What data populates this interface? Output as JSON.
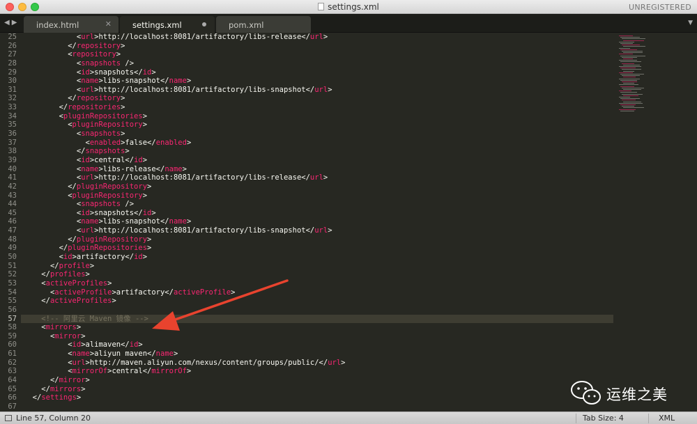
{
  "window": {
    "title": "settings.xml",
    "registration": "UNREGISTERED"
  },
  "tabs": [
    {
      "label": "index.html",
      "state": "clean"
    },
    {
      "label": "settings.xml",
      "state": "clean"
    },
    {
      "label": "pom.xml",
      "state": "modified"
    }
  ],
  "active_tab": "settings.xml",
  "editor": {
    "current_line": 57,
    "lines": [
      {
        "n": "25",
        "indent": 6,
        "parts": [
          [
            "t",
            "<"
          ],
          [
            "url",
            "t2"
          ]
        ]
      },
      {
        "n": "26"
      },
      {
        "n": "27"
      },
      {
        "n": "28"
      },
      {
        "n": "29"
      },
      {
        "n": "30"
      },
      {
        "n": "31"
      },
      {
        "n": "32"
      },
      {
        "n": "33"
      },
      {
        "n": "34"
      },
      {
        "n": "35"
      },
      {
        "n": "36"
      },
      {
        "n": "37"
      },
      {
        "n": "38"
      },
      {
        "n": "39"
      },
      {
        "n": "40"
      },
      {
        "n": "41"
      },
      {
        "n": "42"
      },
      {
        "n": "43"
      },
      {
        "n": "44"
      },
      {
        "n": "45"
      },
      {
        "n": "46"
      },
      {
        "n": "47"
      },
      {
        "n": "48"
      },
      {
        "n": "49"
      },
      {
        "n": "50"
      },
      {
        "n": "51"
      },
      {
        "n": "52"
      },
      {
        "n": "53"
      },
      {
        "n": "54"
      },
      {
        "n": "55"
      },
      {
        "n": "56"
      },
      {
        "n": "57"
      },
      {
        "n": "58"
      },
      {
        "n": "59"
      },
      {
        "n": "60"
      },
      {
        "n": "61"
      },
      {
        "n": "62"
      },
      {
        "n": "63"
      },
      {
        "n": "64"
      },
      {
        "n": "65"
      },
      {
        "n": "66"
      },
      {
        "n": "67"
      }
    ],
    "code": [
      {
        "ind": 6,
        "segs": [
          [
            "p",
            "<"
          ],
          [
            "t",
            "url"
          ],
          [
            "p",
            ">http://localhost:8081/artifactory/libs-release</"
          ],
          [
            "t",
            "url"
          ],
          [
            "p",
            ">"
          ]
        ]
      },
      {
        "ind": 5,
        "segs": [
          [
            "p",
            "</"
          ],
          [
            "t",
            "repository"
          ],
          [
            "p",
            ">"
          ]
        ]
      },
      {
        "ind": 5,
        "segs": [
          [
            "p",
            "<"
          ],
          [
            "t",
            "repository"
          ],
          [
            "p",
            ">"
          ]
        ]
      },
      {
        "ind": 6,
        "segs": [
          [
            "p",
            "<"
          ],
          [
            "t",
            "snapshots"
          ],
          [
            "p",
            " />"
          ]
        ]
      },
      {
        "ind": 6,
        "segs": [
          [
            "p",
            "<"
          ],
          [
            "t",
            "id"
          ],
          [
            "p",
            ">snapshots</"
          ],
          [
            "t",
            "id"
          ],
          [
            "p",
            ">"
          ]
        ]
      },
      {
        "ind": 6,
        "segs": [
          [
            "p",
            "<"
          ],
          [
            "t",
            "name"
          ],
          [
            "p",
            ">libs-snapshot</"
          ],
          [
            "t",
            "name"
          ],
          [
            "p",
            ">"
          ]
        ]
      },
      {
        "ind": 6,
        "segs": [
          [
            "p",
            "<"
          ],
          [
            "t",
            "url"
          ],
          [
            "p",
            ">http://localhost:8081/artifactory/libs-snapshot</"
          ],
          [
            "t",
            "url"
          ],
          [
            "p",
            ">"
          ]
        ]
      },
      {
        "ind": 5,
        "segs": [
          [
            "p",
            "</"
          ],
          [
            "t",
            "repository"
          ],
          [
            "p",
            ">"
          ]
        ]
      },
      {
        "ind": 4,
        "segs": [
          [
            "p",
            "</"
          ],
          [
            "t",
            "repositories"
          ],
          [
            "p",
            ">"
          ]
        ]
      },
      {
        "ind": 4,
        "segs": [
          [
            "p",
            "<"
          ],
          [
            "t",
            "pluginRepositories"
          ],
          [
            "p",
            ">"
          ]
        ]
      },
      {
        "ind": 5,
        "segs": [
          [
            "p",
            "<"
          ],
          [
            "t",
            "pluginRepository"
          ],
          [
            "p",
            ">"
          ]
        ]
      },
      {
        "ind": 6,
        "segs": [
          [
            "p",
            "<"
          ],
          [
            "t",
            "snapshots"
          ],
          [
            "p",
            ">"
          ]
        ]
      },
      {
        "ind": 7,
        "segs": [
          [
            "p",
            "<"
          ],
          [
            "t",
            "enabled"
          ],
          [
            "p",
            ">false</"
          ],
          [
            "t",
            "enabled"
          ],
          [
            "p",
            ">"
          ]
        ]
      },
      {
        "ind": 6,
        "segs": [
          [
            "p",
            "</"
          ],
          [
            "t",
            "snapshots"
          ],
          [
            "p",
            ">"
          ]
        ]
      },
      {
        "ind": 6,
        "segs": [
          [
            "p",
            "<"
          ],
          [
            "t",
            "id"
          ],
          [
            "p",
            ">central</"
          ],
          [
            "t",
            "id"
          ],
          [
            "p",
            ">"
          ]
        ]
      },
      {
        "ind": 6,
        "segs": [
          [
            "p",
            "<"
          ],
          [
            "t",
            "name"
          ],
          [
            "p",
            ">libs-release</"
          ],
          [
            "t",
            "name"
          ],
          [
            "p",
            ">"
          ]
        ]
      },
      {
        "ind": 6,
        "segs": [
          [
            "p",
            "<"
          ],
          [
            "t",
            "url"
          ],
          [
            "p",
            ">http://localhost:8081/artifactory/libs-release</"
          ],
          [
            "t",
            "url"
          ],
          [
            "p",
            ">"
          ]
        ]
      },
      {
        "ind": 5,
        "segs": [
          [
            "p",
            "</"
          ],
          [
            "t",
            "pluginRepository"
          ],
          [
            "p",
            ">"
          ]
        ]
      },
      {
        "ind": 5,
        "segs": [
          [
            "p",
            "<"
          ],
          [
            "t",
            "pluginRepository"
          ],
          [
            "p",
            ">"
          ]
        ]
      },
      {
        "ind": 6,
        "segs": [
          [
            "p",
            "<"
          ],
          [
            "t",
            "snapshots"
          ],
          [
            "p",
            " />"
          ]
        ]
      },
      {
        "ind": 6,
        "segs": [
          [
            "p",
            "<"
          ],
          [
            "t",
            "id"
          ],
          [
            "p",
            ">snapshots</"
          ],
          [
            "t",
            "id"
          ],
          [
            "p",
            ">"
          ]
        ]
      },
      {
        "ind": 6,
        "segs": [
          [
            "p",
            "<"
          ],
          [
            "t",
            "name"
          ],
          [
            "p",
            ">libs-snapshot</"
          ],
          [
            "t",
            "name"
          ],
          [
            "p",
            ">"
          ]
        ]
      },
      {
        "ind": 6,
        "segs": [
          [
            "p",
            "<"
          ],
          [
            "t",
            "url"
          ],
          [
            "p",
            ">http://localhost:8081/artifactory/libs-snapshot</"
          ],
          [
            "t",
            "url"
          ],
          [
            "p",
            ">"
          ]
        ]
      },
      {
        "ind": 5,
        "segs": [
          [
            "p",
            "</"
          ],
          [
            "t",
            "pluginRepository"
          ],
          [
            "p",
            ">"
          ]
        ]
      },
      {
        "ind": 4,
        "segs": [
          [
            "p",
            "</"
          ],
          [
            "t",
            "pluginRepositories"
          ],
          [
            "p",
            ">"
          ]
        ]
      },
      {
        "ind": 4,
        "segs": [
          [
            "p",
            "<"
          ],
          [
            "t",
            "id"
          ],
          [
            "p",
            ">artifactory</"
          ],
          [
            "t",
            "id"
          ],
          [
            "p",
            ">"
          ]
        ]
      },
      {
        "ind": 3,
        "segs": [
          [
            "p",
            "</"
          ],
          [
            "t",
            "profile"
          ],
          [
            "p",
            ">"
          ]
        ]
      },
      {
        "ind": 2,
        "segs": [
          [
            "p",
            "</"
          ],
          [
            "t",
            "profiles"
          ],
          [
            "p",
            ">"
          ]
        ]
      },
      {
        "ind": 2,
        "segs": [
          [
            "p",
            "<"
          ],
          [
            "t",
            "activeProfiles"
          ],
          [
            "p",
            ">"
          ]
        ]
      },
      {
        "ind": 3,
        "segs": [
          [
            "p",
            "<"
          ],
          [
            "t",
            "activeProfile"
          ],
          [
            "p",
            ">artifactory</"
          ],
          [
            "t",
            "activeProfile"
          ],
          [
            "p",
            ">"
          ]
        ]
      },
      {
        "ind": 2,
        "segs": [
          [
            "p",
            "</"
          ],
          [
            "t",
            "activeProfiles"
          ],
          [
            "p",
            ">"
          ]
        ]
      },
      {
        "ind": 0,
        "segs": []
      },
      {
        "ind": 2,
        "segs": [
          [
            "c",
            "<!-- 阿里云 Maven 镜像 -->"
          ]
        ]
      },
      {
        "ind": 2,
        "segs": [
          [
            "p",
            "<"
          ],
          [
            "t",
            "mirrors"
          ],
          [
            "p",
            ">"
          ]
        ]
      },
      {
        "ind": 3,
        "segs": [
          [
            "p",
            "<"
          ],
          [
            "t",
            "mirror"
          ],
          [
            "p",
            ">"
          ]
        ]
      },
      {
        "ind": 5,
        "segs": [
          [
            "p",
            "<"
          ],
          [
            "t",
            "id"
          ],
          [
            "p",
            ">alimaven</"
          ],
          [
            "t",
            "id"
          ],
          [
            "p",
            ">"
          ]
        ]
      },
      {
        "ind": 5,
        "segs": [
          [
            "p",
            "<"
          ],
          [
            "t",
            "name"
          ],
          [
            "p",
            ">aliyun maven</"
          ],
          [
            "t",
            "name"
          ],
          [
            "p",
            ">"
          ]
        ]
      },
      {
        "ind": 5,
        "segs": [
          [
            "p",
            "<"
          ],
          [
            "t",
            "url"
          ],
          [
            "p",
            ">http://maven.aliyun.com/nexus/content/groups/public/</"
          ],
          [
            "t",
            "url"
          ],
          [
            "p",
            ">"
          ]
        ]
      },
      {
        "ind": 5,
        "segs": [
          [
            "p",
            "<"
          ],
          [
            "t",
            "mirrorOf"
          ],
          [
            "p",
            ">central</"
          ],
          [
            "t",
            "mirrorOf"
          ],
          [
            "p",
            ">"
          ]
        ]
      },
      {
        "ind": 3,
        "segs": [
          [
            "p",
            "</"
          ],
          [
            "t",
            "mirror"
          ],
          [
            "p",
            ">"
          ]
        ]
      },
      {
        "ind": 2,
        "segs": [
          [
            "p",
            "</"
          ],
          [
            "t",
            "mirrors"
          ],
          [
            "p",
            ">"
          ]
        ]
      },
      {
        "ind": 1,
        "segs": [
          [
            "p",
            "</"
          ],
          [
            "t",
            "settings"
          ],
          [
            "p",
            ">"
          ]
        ]
      },
      {
        "ind": 0,
        "segs": []
      }
    ]
  },
  "watermark": {
    "text": "运维之美"
  },
  "status": {
    "position": "Line 57, Column 20",
    "tab_size": "Tab Size: 4",
    "syntax": "XML"
  },
  "colors": {
    "background": "#272822",
    "tag": "#f92672",
    "text": "#f8f8f2",
    "comment": "#75715e",
    "line_number": "#90908a",
    "arrow": "#e8432e"
  },
  "icons": {
    "tab_nav": "left-right-arrows-icon",
    "tab_close": "close-icon",
    "tab_modified": "modified-dot-icon",
    "tab_menu": "chevron-down-icon",
    "watermark_logo": "wechat-icon",
    "status_panel": "panel-icon"
  }
}
